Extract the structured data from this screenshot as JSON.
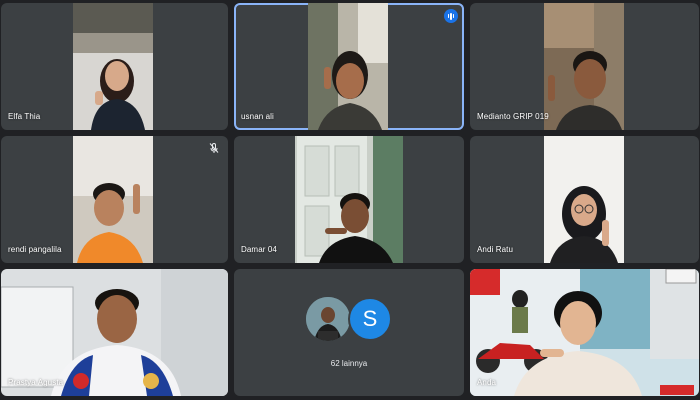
{
  "meeting": {
    "participants": [
      {
        "name": "Elfa Thia"
      },
      {
        "name": "usnan ali"
      },
      {
        "name": "Medianto GRIP 019"
      },
      {
        "name": "rendi pangalila"
      },
      {
        "name": "Damar 04"
      },
      {
        "name": "Andi Ratu"
      },
      {
        "name": "Prastya Agusta"
      },
      {
        "name": "Anda"
      }
    ],
    "others": {
      "avatar_letter": "S",
      "label": "62 lainnya"
    }
  },
  "colors": {
    "background": "#202124",
    "tile": "#3c4043",
    "active_border": "#8ab4f8",
    "avatar_blue": "#1e88e5"
  }
}
